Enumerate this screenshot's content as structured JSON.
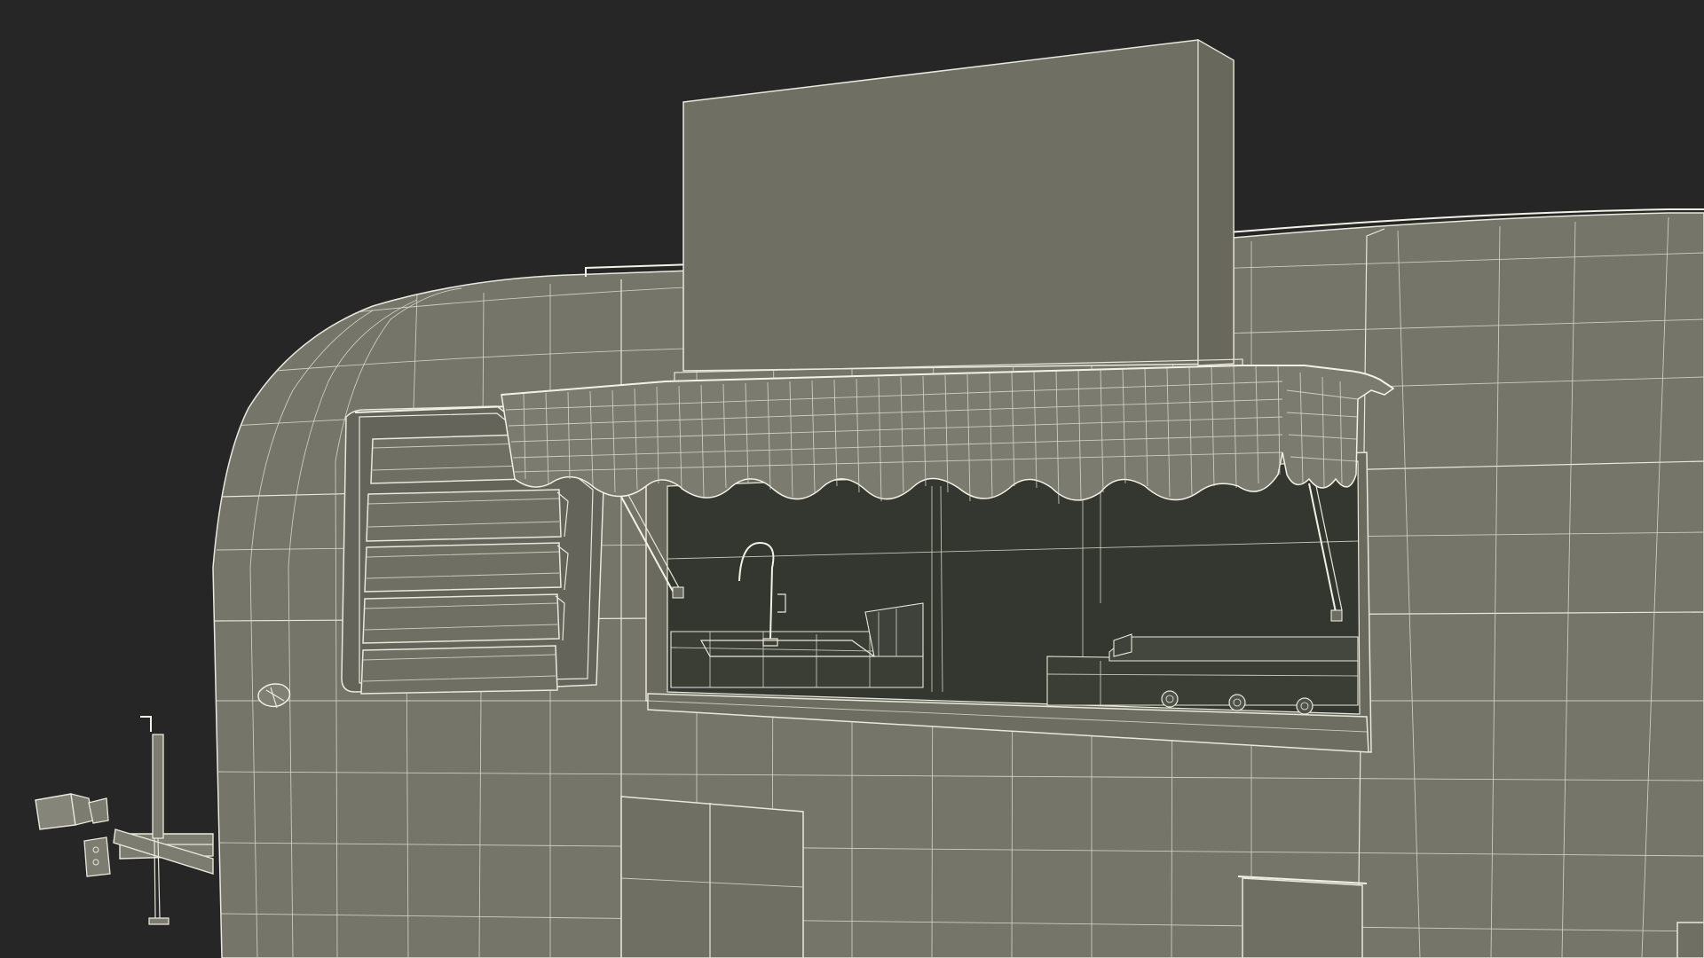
{
  "viewport": {
    "background_color": "#262626"
  },
  "model": {
    "subject": "food-trailer",
    "render_mode": "wireframe-on-shaded",
    "colors": {
      "surface": "#757569",
      "surface_dark": "#66665c",
      "interior": "#34372f",
      "wire": "#e9e8dc"
    },
    "parts": [
      "trailer-body",
      "sign-board",
      "service-window",
      "awning",
      "louvered-window",
      "kitchen-interior",
      "sink-faucet",
      "griddle",
      "stove-knobs",
      "gas-struts",
      "hitch-tongue",
      "jack-stand",
      "marker-light",
      "access-door",
      "lower-hatch"
    ],
    "stove_knob_count": 3,
    "louver_slat_count": 5
  }
}
